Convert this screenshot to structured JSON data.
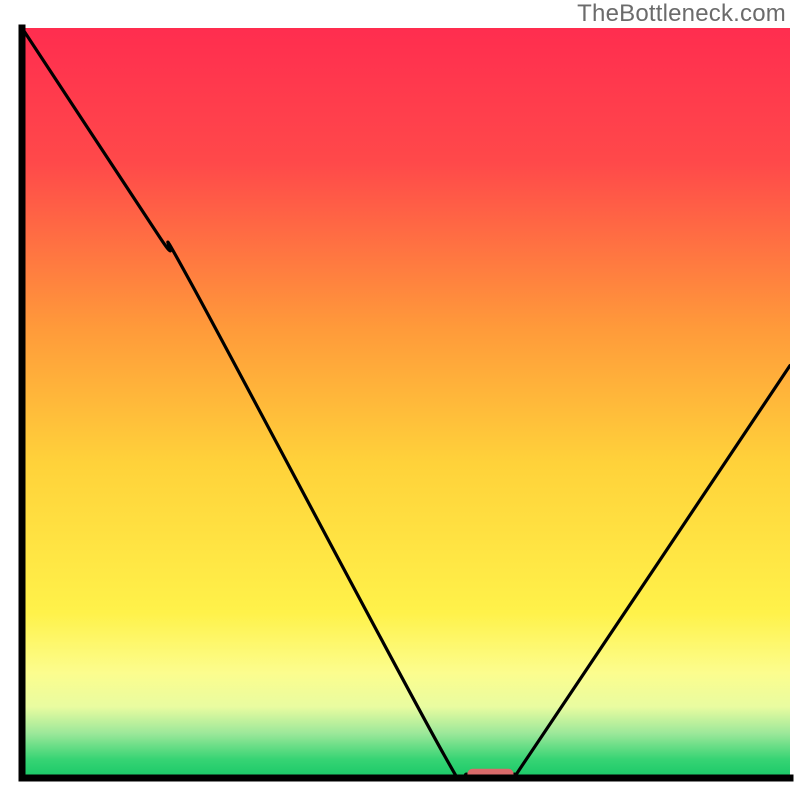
{
  "watermark": "TheBottleneck.com",
  "chart_data": {
    "type": "line",
    "title": "",
    "xlabel": "",
    "ylabel": "",
    "xlim": [
      0,
      100
    ],
    "ylim": [
      0,
      100
    ],
    "grid": false,
    "legend": false,
    "curve_points": [
      {
        "x": 0,
        "y": 100
      },
      {
        "x": 18,
        "y": 72
      },
      {
        "x": 22,
        "y": 66
      },
      {
        "x": 55,
        "y": 3
      },
      {
        "x": 58,
        "y": 0.5
      },
      {
        "x": 64,
        "y": 0.5
      },
      {
        "x": 66,
        "y": 3
      },
      {
        "x": 100,
        "y": 55
      }
    ],
    "flat_marker": {
      "x_start": 58,
      "x_end": 64,
      "y": 0.5,
      "color": "#d96a6a"
    },
    "background_gradient_stops": [
      {
        "offset": 0.0,
        "color": "#ff2d4f"
      },
      {
        "offset": 0.18,
        "color": "#ff494a"
      },
      {
        "offset": 0.4,
        "color": "#ff9a3a"
      },
      {
        "offset": 0.58,
        "color": "#ffd23a"
      },
      {
        "offset": 0.78,
        "color": "#fff24a"
      },
      {
        "offset": 0.86,
        "color": "#fcfd8e"
      },
      {
        "offset": 0.905,
        "color": "#e9fca0"
      },
      {
        "offset": 0.94,
        "color": "#9de89a"
      },
      {
        "offset": 0.975,
        "color": "#37d474"
      },
      {
        "offset": 1.0,
        "color": "#18c867"
      }
    ],
    "axis_border_color": "#000000",
    "curve_stroke_color": "#000000",
    "curve_stroke_width": 3.2
  }
}
